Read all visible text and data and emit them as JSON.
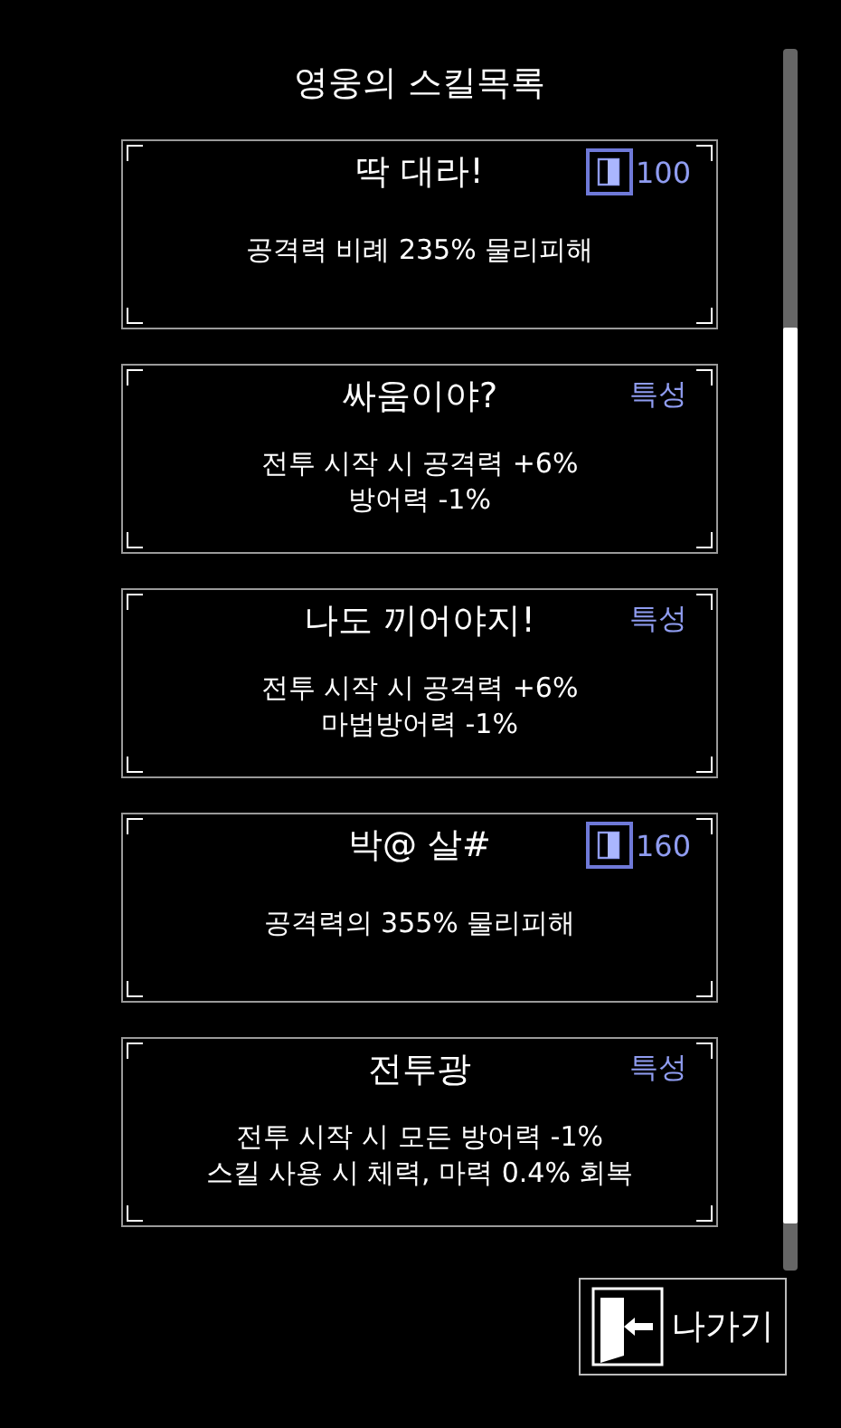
{
  "title": "영웅의 스킬목록",
  "skills": [
    {
      "kind": "active",
      "name": "딱 대라!",
      "cost": "100",
      "lines": [
        "공격력 비례 235% 물리피해"
      ]
    },
    {
      "kind": "trait",
      "name": "싸움이야?",
      "tag": "특성",
      "lines": [
        "전투 시작 시 공격력 +6%",
        "방어력 -1%"
      ]
    },
    {
      "kind": "trait",
      "name": "나도 끼어야지!",
      "tag": "특성",
      "lines": [
        "전투 시작 시 공격력 +6%",
        "마법방어력 -1%"
      ]
    },
    {
      "kind": "active",
      "name": "박@ 살#",
      "cost": "160",
      "lines": [
        "공격력의 355% 물리피해"
      ]
    },
    {
      "kind": "trait",
      "name": "전투광",
      "tag": "특성",
      "lines": [
        "전투 시작 시 모든 방어력 -1%",
        "스킬 사용 시 체력, 마력 0.4% 회복"
      ]
    }
  ],
  "exit_button": "나가기"
}
